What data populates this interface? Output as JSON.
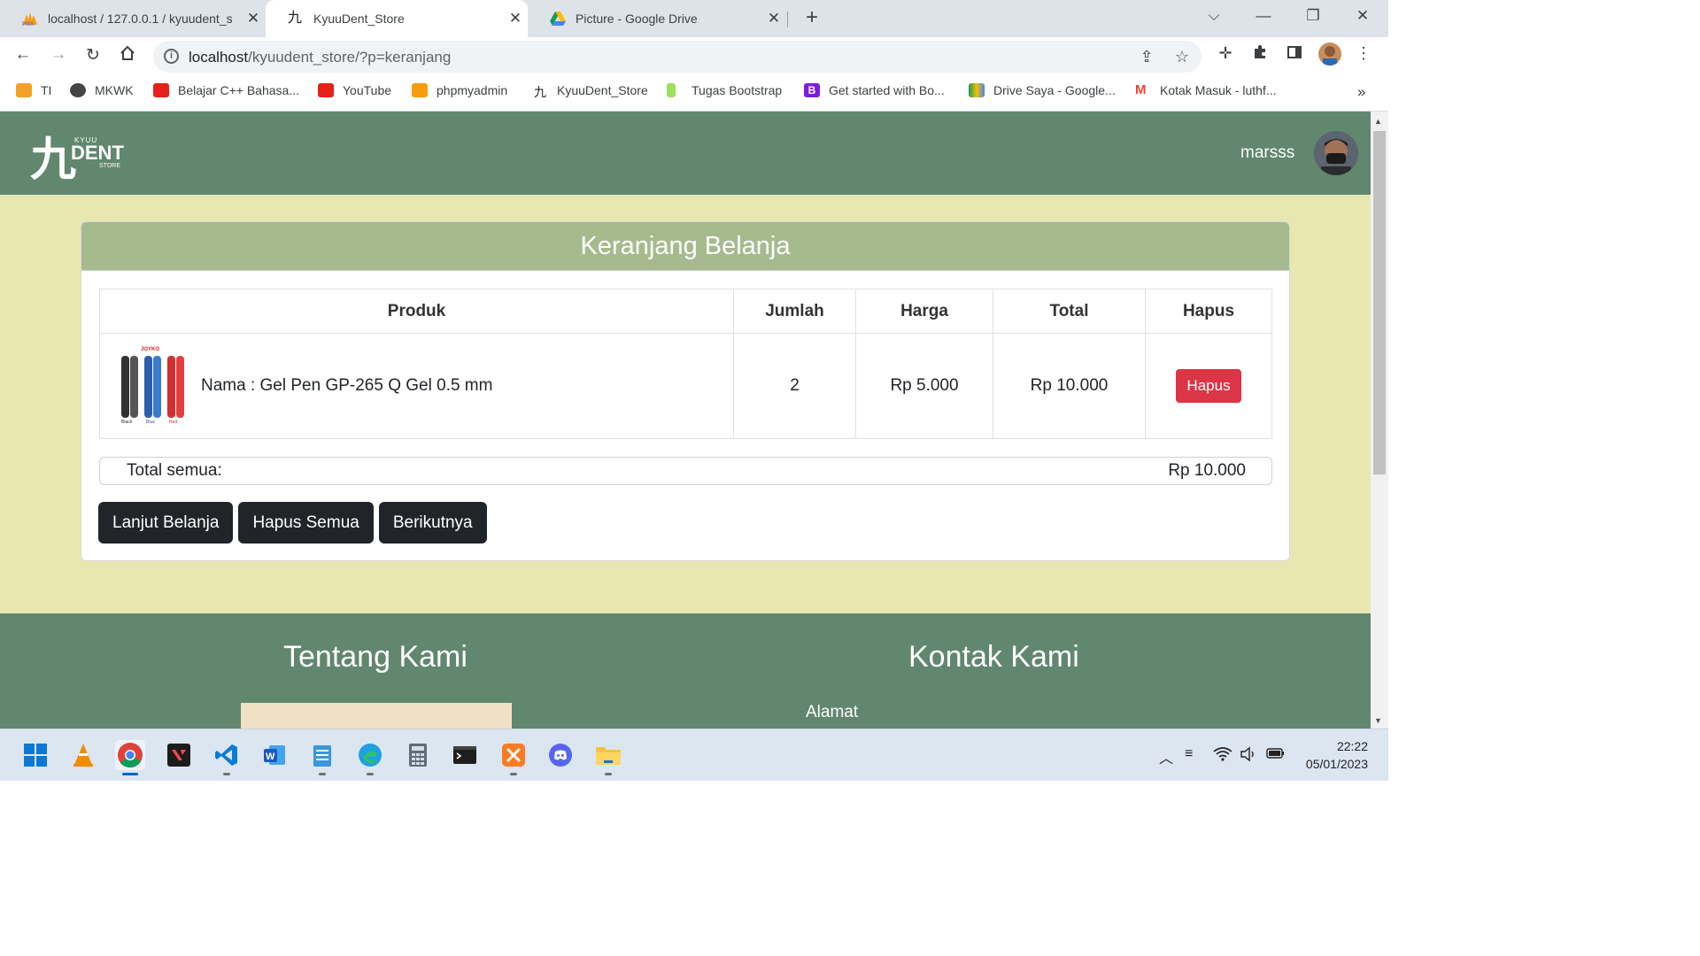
{
  "browser": {
    "tabs": [
      {
        "title": "localhost / 127.0.0.1 / kyuudent_s"
      },
      {
        "title": "KyuuDent_Store"
      },
      {
        "title": "Picture - Google Drive"
      }
    ],
    "url_host": "localhost",
    "url_path": "/kyuudent_store/?p=keranjang",
    "bookmarks": [
      {
        "label": "TI"
      },
      {
        "label": "MKWK"
      },
      {
        "label": "Belajar C++ Bahasa..."
      },
      {
        "label": "YouTube"
      },
      {
        "label": "phpmyadmin"
      },
      {
        "label": "KyuuDent_Store"
      },
      {
        "label": "Tugas Bootstrap"
      },
      {
        "label": "Get started with Bo..."
      },
      {
        "label": "Drive Saya - Google..."
      },
      {
        "label": "Kotak Masuk - luthf..."
      }
    ],
    "bookmarks_more": "»"
  },
  "site": {
    "logo_big": "九",
    "logo_small_top": "KYUU",
    "logo_main": "DENT",
    "logo_small_bottom": "STORE",
    "username": "marsss"
  },
  "cart": {
    "title": "Keranjang Belanja",
    "columns": [
      "Produk",
      "Jumlah",
      "Harga",
      "Total",
      "Hapus"
    ],
    "items": [
      {
        "name": "Nama : Gel Pen GP-265 Q Gel 0.5 mm",
        "qty": "2",
        "price": "Rp 5.000",
        "total": "Rp 10.000",
        "delete_label": "Hapus",
        "image_brand": "JOYKO",
        "image_labels": [
          "Black",
          "Blue",
          "Red"
        ]
      }
    ],
    "total_label": "Total semua:",
    "total_value": "Rp 10.000",
    "buttons": {
      "continue": "Lanjut Belanja",
      "clear": "Hapus Semua",
      "next": "Berikutnya"
    }
  },
  "footer": {
    "about_title": "Tentang Kami",
    "contact_title": "Kontak Kami",
    "address_label": "Alamat"
  },
  "taskbar": {
    "time": "22:22",
    "date": "05/01/2023"
  },
  "colors": {
    "header": "#61876e",
    "page_bg": "#e8e6b1",
    "card_header": "#a6bb8d",
    "danger": "#dc3545",
    "dark_button": "#212529"
  }
}
